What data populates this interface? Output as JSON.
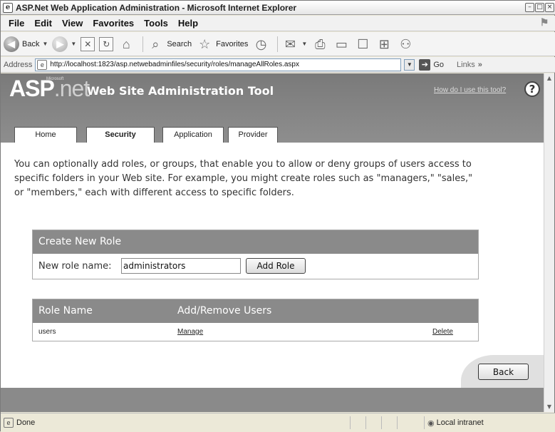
{
  "window": {
    "title": "ASP.Net Web Application Administration - Microsoft Internet Explorer"
  },
  "menu": [
    "File",
    "Edit",
    "View",
    "Favorites",
    "Tools",
    "Help"
  ],
  "toolbar": {
    "back": "Back",
    "search": "Search",
    "favorites": "Favorites"
  },
  "address": {
    "label": "Address",
    "url": "http://localhost:1823/asp.netwebadminfiles/security/roles/manageAllRoles.aspx",
    "go": "Go",
    "links": "Links"
  },
  "header": {
    "logo_asp": "ASP",
    "logo_net": ".net",
    "logo_ms": "Microsoft",
    "site_title": "Web Site Administration Tool",
    "help_link": "How do I use this tool?",
    "help_icon": "?"
  },
  "tabs": [
    "Home",
    "Security",
    "Application",
    "Provider"
  ],
  "active_tab": "Security",
  "intro": "You can optionally add roles, or groups, that enable you to allow or deny groups of users access to specific folders in your Web site. For example, you might create roles such as \"managers,\" \"sales,\" or \"members,\" each with different access to specific folders.",
  "create_role": {
    "heading": "Create New Role",
    "label": "New role name:",
    "value": "administrators",
    "button": "Add Role"
  },
  "roles_table": {
    "headers": [
      "Role Name",
      "Add/Remove Users"
    ],
    "rows": [
      {
        "name": "users",
        "manage": "Manage",
        "delete": "Delete"
      }
    ]
  },
  "back_button": "Back",
  "status": {
    "text": "Done",
    "zone": "Local intranet"
  }
}
